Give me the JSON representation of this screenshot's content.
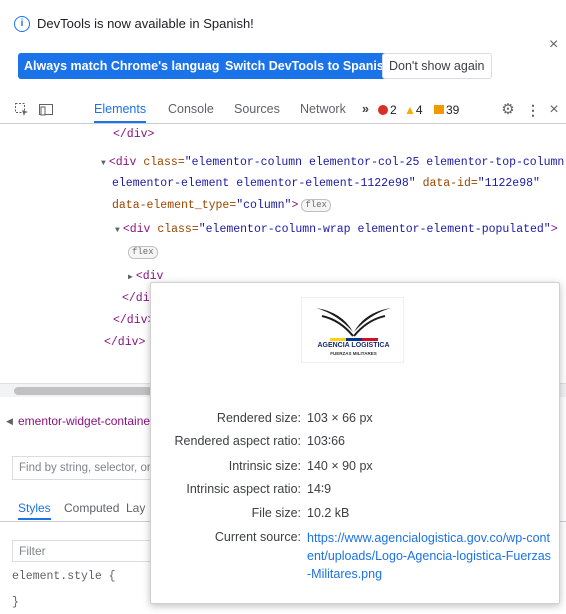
{
  "notification": {
    "message": "DevTools is now available in Spanish!",
    "buttons": [
      "Always match Chrome's language",
      "Switch DevTools to Spanish",
      "Don't show again"
    ],
    "close": "×"
  },
  "toolbar": {
    "tabs": [
      "Elements",
      "Console",
      "Sources",
      "Network"
    ],
    "more": "»",
    "errors": "2",
    "warnings": "4",
    "issues": "39",
    "close": "×"
  },
  "tree": {
    "l1": "</div>",
    "l2_tag": "<div",
    "l2_attr": "class=",
    "l2_val": "\"elementor-column elementor-col-25 elementor-top-column",
    "l3_val": "elementor-element elementor-element-1122e98\"",
    "l3_attr": "data-id=",
    "l3_val2": "\"1122e98\"",
    "l4_attr": "data-element_type=",
    "l4_val": "\"column\"",
    "l4_close": ">",
    "pill": "flex",
    "l5_tag": "<div",
    "l5_attr": "class=",
    "l5_val": "\"elementor-column-wrap elementor-element-populated\"",
    "l5_close": ">",
    "l7_tag": "<div",
    "l8": "</div>",
    "l9": "</div>",
    "l10": "</div>"
  },
  "breadcrumb": "ementor-widget-containe",
  "search_placeholder": "Find by string, selector, or X",
  "subtabs": [
    "Styles",
    "Computed",
    "Lay"
  ],
  "filter_placeholder": "Filter",
  "element_style": "element.style {",
  "element_style_close": "}",
  "tooltip": {
    "logo_line1": "AGENCIA LOGISTICA",
    "logo_line2": "FUERZAS MILITARES",
    "rows": [
      {
        "key": "Rendered size:",
        "value": "103 × 66 px"
      },
      {
        "key": "Rendered aspect ratio:",
        "value": "103∶66"
      },
      {
        "key": "Intrinsic size:",
        "value": "140 × 90 px"
      },
      {
        "key": "Intrinsic aspect ratio:",
        "value": "14∶9"
      },
      {
        "key": "File size:",
        "value": "10.2 kB"
      }
    ],
    "source_key": "Current source:",
    "source_lines": [
      "https://www.agencialogistica.gov.co/wp-cont",
      "ent/uploads/Logo-Agencia-logistica-Fuerzas",
      "-Militares.png"
    ]
  },
  "colors": {
    "accent": "#1a73e8",
    "error": "#d93025",
    "warning": "#f9ab00",
    "issue": "#f29900"
  }
}
